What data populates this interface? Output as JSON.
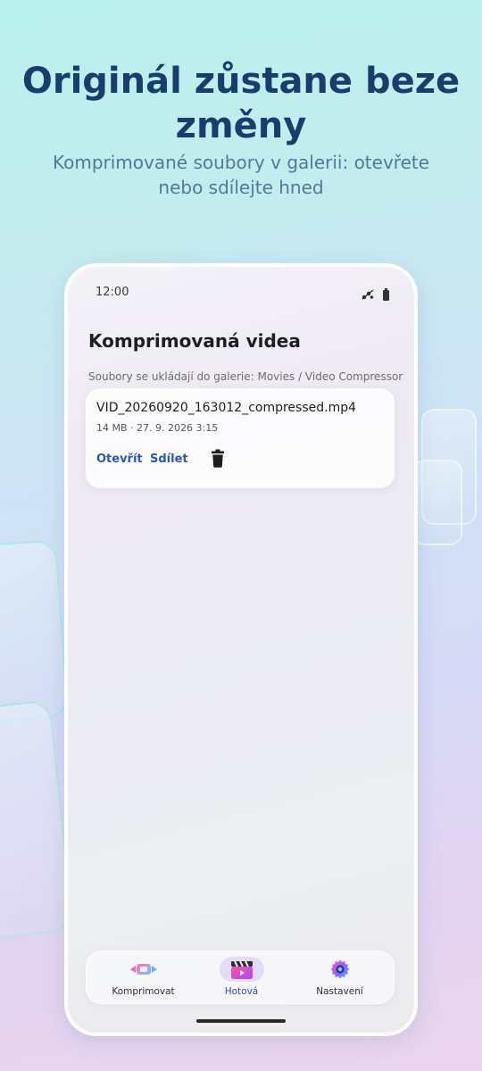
{
  "promo": {
    "headline": "Originál zůstane beze změny",
    "subline": "Komprimované soubory v galerii: otevřete nebo sdílejte hned"
  },
  "status_bar": {
    "time": "12:00",
    "icons": [
      "network-icon",
      "battery-icon"
    ]
  },
  "screen": {
    "title": "Komprimovaná videa",
    "caption": "Soubory se ukládají do galerie: Movies / Video Compressor"
  },
  "file": {
    "name": "VID_20260920_163012_compressed.mp4",
    "meta": "14 MB · 27. 9. 2026 3:15",
    "open_label": "Otevřít",
    "share_label": "Sdílet",
    "delete_icon": "trash-icon"
  },
  "nav": {
    "items": [
      {
        "label": "Komprimovat",
        "icon": "compress-icon",
        "active": false
      },
      {
        "label": "Hotová",
        "icon": "clapperboard-icon",
        "active": true
      },
      {
        "label": "Nastavení",
        "icon": "gear-icon",
        "active": false
      }
    ]
  },
  "colors": {
    "headline": "#1b3d6e",
    "subline": "#4f7a9a",
    "accent": "#2a57b0",
    "active_pill": "#e6dbf6"
  }
}
